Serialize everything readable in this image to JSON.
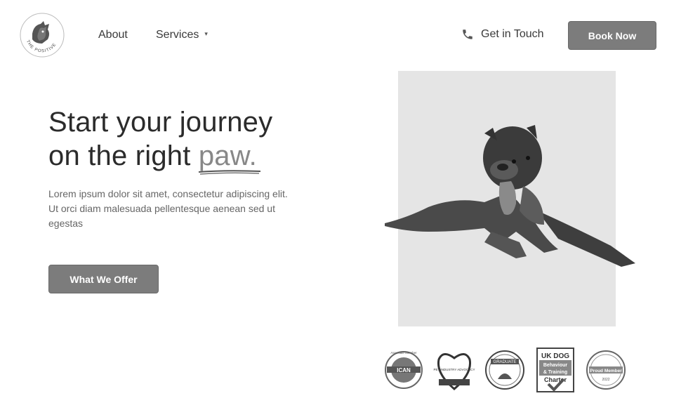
{
  "brand": {
    "name": "THE POSITIVE PUP"
  },
  "nav": {
    "about": "About",
    "services": "Services",
    "services_caret": "▾",
    "contact": "Get in Touch",
    "book": "Book Now"
  },
  "hero": {
    "title_line1": "Start your journey",
    "title_line2_prefix": "on the right ",
    "title_accent": "paw.",
    "description": "Lorem ipsum dolor sit amet, consectetur adipiscing elit. Ut orci diam malesuada pellentesque aenean sed ut egestas",
    "cta": "What We Offer"
  },
  "badges": [
    {
      "icon": "ican-badge",
      "label": "ICAN",
      "caption": "Associate Member"
    },
    {
      "icon": "pet-advocacy-badge",
      "label": "PET INDUSTRY ADVOCACY",
      "caption": ""
    },
    {
      "icon": "graduate-badge",
      "label": "GRADUATE",
      "caption": ""
    },
    {
      "icon": "uk-dog-charter-badge",
      "label": "UK DOG Behaviour & Training Charter",
      "caption": ""
    },
    {
      "icon": "proud-member-badge",
      "label": "Proud Member",
      "caption": "2022"
    }
  ],
  "colors": {
    "button": "#7c7c7c",
    "text_dark": "#2b2b2b",
    "text_muted": "#666666",
    "photo_bg": "#e5e5e5"
  }
}
